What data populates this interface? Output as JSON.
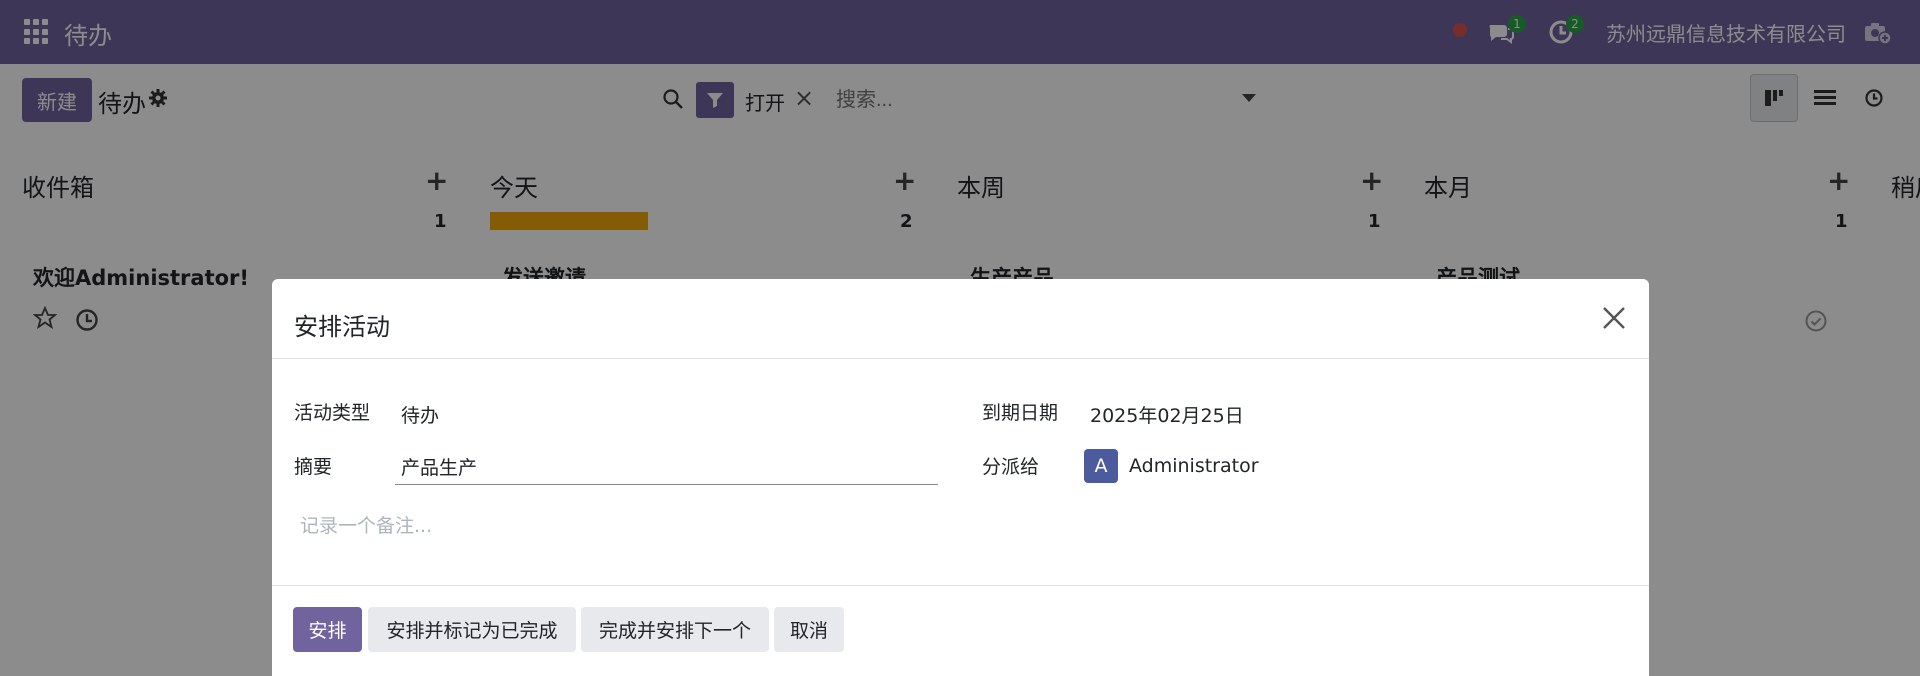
{
  "topbar": {
    "app_title": "待办",
    "messages_count": "1",
    "activities_count": "2",
    "company": "苏州远鼎信息技术有限公司"
  },
  "control": {
    "new_button": "新建",
    "breadcrumb": "待办",
    "filter_facet": "打开",
    "search_placeholder": "搜索..."
  },
  "kanban": {
    "columns": [
      {
        "title": "收件箱",
        "count": "1",
        "card_title": "欢迎Administrator!"
      },
      {
        "title": "今天",
        "count": "2",
        "card_title": "发送邀请"
      },
      {
        "title": "本周",
        "count": "1",
        "card_title": "生产产品"
      },
      {
        "title": "本月",
        "count": "1",
        "card_title": "产品测试"
      },
      {
        "title": "稍后"
      }
    ],
    "today_progress": 1.0
  },
  "dialog": {
    "title": "安排活动",
    "activity_type_label": "活动类型",
    "activity_type_value": "待办",
    "summary_label": "摘要",
    "summary_value": "产品生产",
    "due_date_label": "到期日期",
    "due_date_value": "2025年02月25日",
    "assigned_label": "分派给",
    "assigned_initial": "A",
    "assigned_value": "Administrator",
    "note_placeholder": "记录一个备注...",
    "buttons": {
      "schedule": "安排",
      "schedule_done": "安排并标记为已完成",
      "done_next": "完成并安排下一个",
      "cancel": "取消"
    }
  },
  "colors": {
    "brand": "#71639e",
    "progress": "#f3a80c",
    "badge": "#28a745"
  }
}
